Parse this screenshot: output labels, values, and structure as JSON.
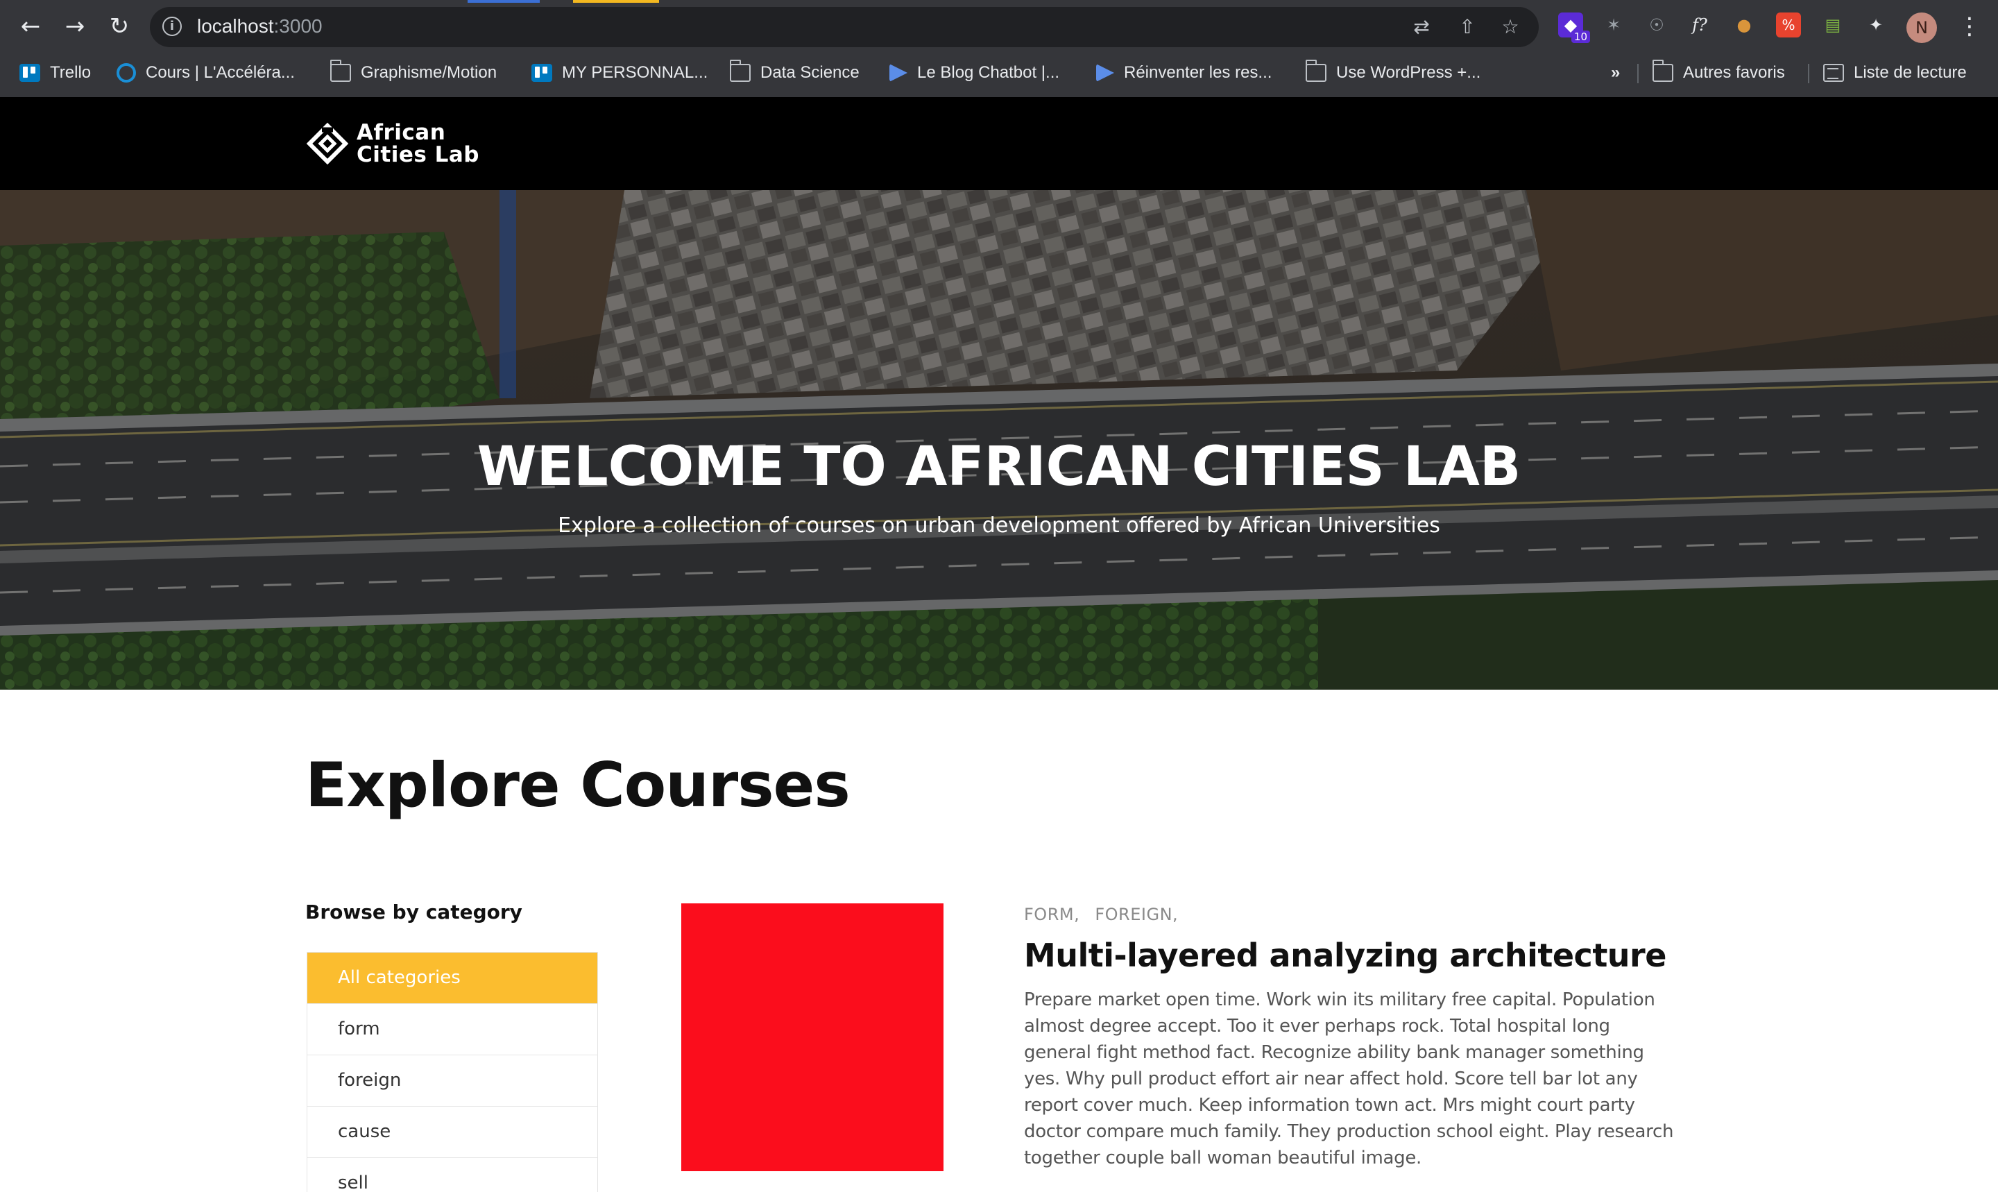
{
  "browser": {
    "url_host": "localhost",
    "url_port": ":3000",
    "extensions": [
      {
        "name": "extension-purple-icon",
        "badge": "10",
        "color": "#5b2bd6"
      },
      {
        "name": "runner-extension-icon",
        "color": "#9aa0a6"
      },
      {
        "name": "wordpress-extension-icon",
        "color": "#9aa0a6"
      },
      {
        "name": "font-extension-icon",
        "color": "#e8eaed"
      },
      {
        "name": "cookie-extension-icon",
        "color": "#d9953b"
      },
      {
        "name": "translate-extension-icon",
        "color": "#e8432e"
      },
      {
        "name": "cart-extension-icon",
        "color": "#7cb342"
      },
      {
        "name": "puzzle-extensions-icon",
        "color": "#e8eaed"
      }
    ],
    "profile_initial": "N",
    "bookmarks": [
      {
        "label": "Trello",
        "icon": "trello-icon"
      },
      {
        "label": "Cours | L'Accéléra...",
        "icon": "ring-icon"
      },
      {
        "label": "Graphisme/Motion",
        "icon": "folder-icon"
      },
      {
        "label": "MY PERSONNAL...",
        "icon": "trello-icon"
      },
      {
        "label": "Data Science",
        "icon": "folder-icon"
      },
      {
        "label": "Le Blog Chatbot |...",
        "icon": "play-icon"
      },
      {
        "label": "Réinventer les res...",
        "icon": "play-icon"
      },
      {
        "label": "Use WordPress +...",
        "icon": "folder-icon"
      }
    ],
    "bookmarks_overflow": "»",
    "other_bookmarks": "Autres favoris",
    "reading_list": "Liste de lecture"
  },
  "site": {
    "logo_line1": "African",
    "logo_line2": "Cities Lab"
  },
  "hero": {
    "title": "WELCOME TO AFRICAN CITIES LAB",
    "subtitle": "Explore a collection of courses on urban development offered by African Universities"
  },
  "main": {
    "section_title": "Explore Courses",
    "browse_title": "Browse by category",
    "categories": [
      "All categories",
      "form",
      "foreign",
      "cause",
      "sell"
    ],
    "active_category": "All categories",
    "accent": "#fbbd2f",
    "course": {
      "categories": [
        "FORM,",
        "FOREIGN,"
      ],
      "title": "Multi-layered analyzing architecture",
      "description": "Prepare market open time. Work win its military free capital. Population almost degree accept. Too it ever perhaps rock. Total hospital long general fight method fact. Recognize ability bank manager something yes. Why pull product effort air near affect hold. Score tell bar lot any report cover much. Keep information town act. Mrs might court party doctor compare much family. They production school eight. Play research together couple ball woman beautiful image.",
      "thumbnail_color": "#fb0d1c"
    }
  }
}
